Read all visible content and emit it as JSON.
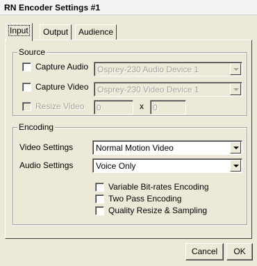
{
  "window": {
    "title": "RN Encoder Settings #1"
  },
  "tabs": [
    {
      "label": "Input"
    },
    {
      "label": "Output"
    },
    {
      "label": "Audience"
    }
  ],
  "source": {
    "title": "Source",
    "capture_audio": {
      "label": "Capture Audio",
      "checked": false,
      "device": "Osprey-230 Audio Device 1"
    },
    "capture_video": {
      "label": "Capture Video",
      "checked": false,
      "device": "Osprey-230 Video Device 1"
    },
    "resize_video": {
      "label": "Resize Video",
      "checked": false,
      "width": "0",
      "separator": "x",
      "height": "0"
    }
  },
  "encoding": {
    "title": "Encoding",
    "video_settings": {
      "label": "Video Settings",
      "value": "Normal Motion Video"
    },
    "audio_settings": {
      "label": "Audio Settings",
      "value": "Voice Only"
    },
    "options": [
      {
        "label": "Variable Bit-rates Encoding",
        "checked": false
      },
      {
        "label": "Two Pass Encoding",
        "checked": false
      },
      {
        "label": "Quality Resize & Sampling",
        "checked": false
      }
    ]
  },
  "buttons": {
    "cancel": "Cancel",
    "ok": "OK"
  }
}
